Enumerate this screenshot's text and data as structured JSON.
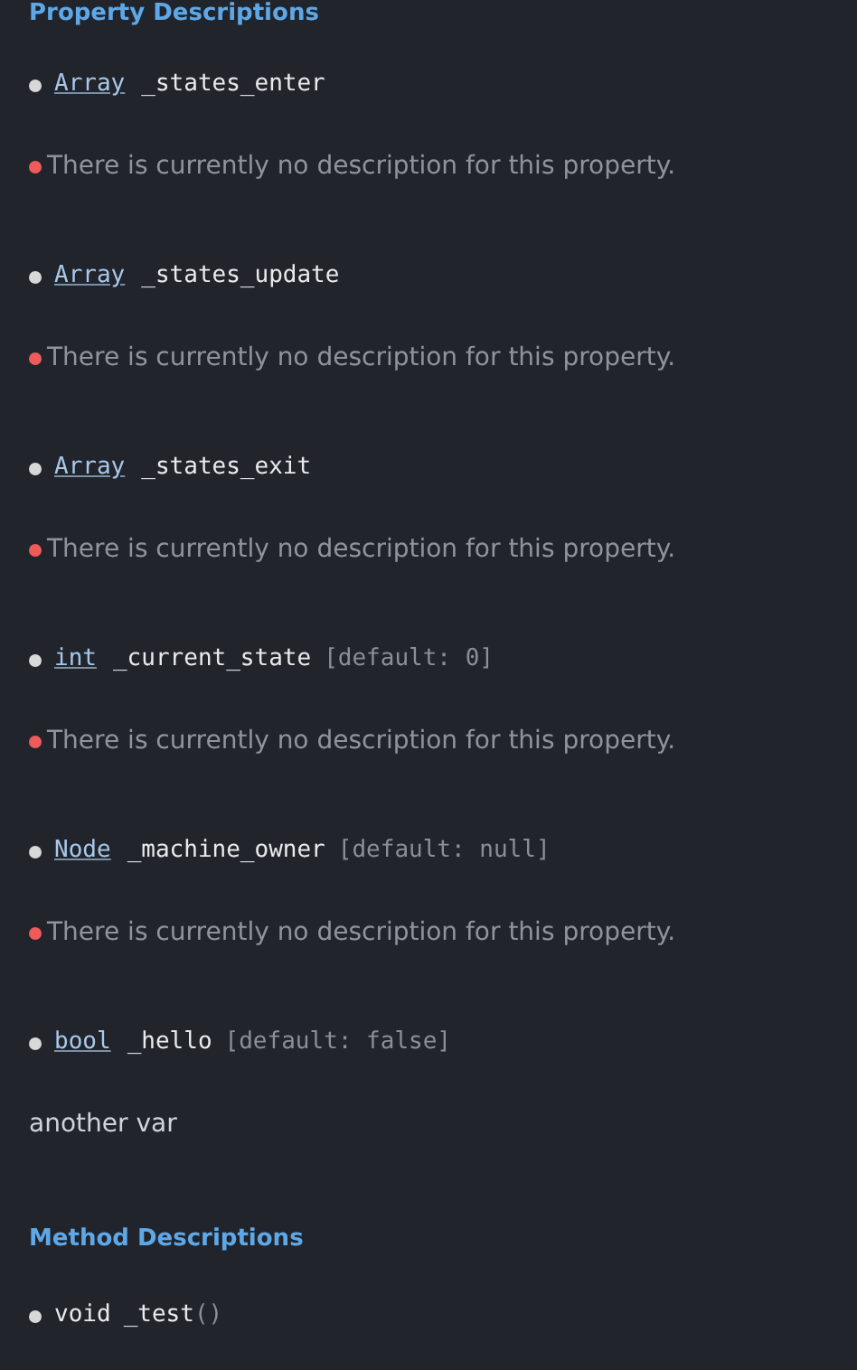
{
  "property_heading": "Property Descriptions",
  "properties": [
    {
      "type": "Array",
      "name": "_states_enter",
      "description": {
        "kind": "missing",
        "text": "There is currently no description for this property."
      }
    },
    {
      "type": "Array",
      "name": "_states_update",
      "description": {
        "kind": "missing",
        "text": "There is currently no description for this property."
      }
    },
    {
      "type": "Array",
      "name": "_states_exit",
      "description": {
        "kind": "missing",
        "text": "There is currently no description for this property."
      }
    },
    {
      "type": "int",
      "name": "_current_state",
      "default": "[default: 0]",
      "description": {
        "kind": "missing",
        "text": "There is currently no description for this property."
      }
    },
    {
      "type": "Node",
      "name": "_machine_owner",
      "default": "[default: null]",
      "description": {
        "kind": "missing",
        "text": "There is currently no description for this property."
      }
    },
    {
      "type": "bool",
      "name": "_hello",
      "default": "[default: false]",
      "description": {
        "kind": "text",
        "text": "another var"
      }
    }
  ],
  "method_heading": "Method Descriptions",
  "methods": [
    {
      "return_type": "void",
      "name": "_test",
      "parens": "()"
    }
  ]
}
